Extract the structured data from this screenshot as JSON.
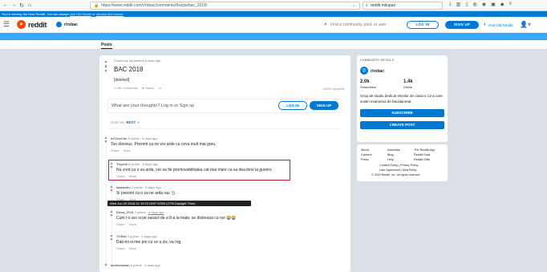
{
  "browser": {
    "url": "https://www.reddit.com/r/robac/comments/8xzpis/bac_2018/",
    "search_value": "reddit milupas"
  },
  "banner": {
    "text": "You're viewing the New Reddit. You can always",
    "link1": "visit Old Reddit",
    "mid": "or",
    "link2": "dismiss this banner"
  },
  "header": {
    "brand": "reddit",
    "subreddit": "r/robac",
    "search_placeholder": "Find a community, post, or user",
    "login": "LOG IN",
    "signup": "SIGN UP",
    "old_reddit": "Visit Old Reddit"
  },
  "tabs": {
    "posts": "Posts"
  },
  "post": {
    "meta": "Posted by u/[deleted] 6 days ago",
    "title": "BAC 2018",
    "body": "[deleted]",
    "comments": "56 Comments",
    "share": "Share",
    "upvoted": "100% Upvoted",
    "score": "1"
  },
  "comment_box": {
    "prompt": "What are your thoughts? Log in or Sign up",
    "login": "LOG IN",
    "signup": "SIGN UP"
  },
  "sort": {
    "label": "SORT BY",
    "value": "BEST"
  },
  "comments": [
    {
      "user": "hOZzzVvile",
      "points": "8 points",
      "time": "6 days ago",
      "body": "Too obvious. Presimt ca ne vor arde cu ceva mult mai greu.",
      "share": "Share",
      "save": "Save"
    },
    {
      "user": "Treyvoii",
      "points": "6 points",
      "time": "6 days ago",
      "body": "Nu cred ca o sa arda, vor sa fie promovabilitatea cat mai mare ca sa dea bine la guvern",
      "share": "Share",
      "save": "Save"
    },
    {
      "user": "fassandru",
      "points": "3 points",
      "time": "6 days ago",
      "body": "Si presimt ca o sa ne arda rau :))",
      "share": "Share",
      "save": "Save"
    },
    {
      "user": "Elena_2015",
      "points": "2 points",
      "time": "5 days ago",
      "body": "Cum i-o ars si pe saracii de a 8-a la mate, se distreaza cu noi 😭😭",
      "share": "Share",
      "save": "Save"
    },
    {
      "user": "YZ3ble",
      "points": "3 points",
      "time": "6 days ago",
      "body": "Dati-mi si mie pm cu ce a zis, va rog",
      "share": "Share",
      "save": "Save"
    },
    {
      "user": "andreeaorian",
      "points": "6 points",
      "time": "6 days ago",
      "body": "",
      "share": "",
      "save": ""
    }
  ],
  "tooltip": "Wed Jun 20 2018 01:19:15 GMT+0300 (GTB Daylight Time)",
  "sidebar": {
    "heading": "COMMUNITY DETAILS",
    "name": "r/robac",
    "subscribers_value": "2.0k",
    "subscribers_label": "Subscribers",
    "online_value": "1.4k",
    "online_label": "Online",
    "description": "Grup de studiu dedicat elevilor de clasa a 12-a care sustin examenul de bacalaureat.",
    "subscribe": "SUBSCRIBE",
    "create_post": "CREATE POST"
  },
  "footer": {
    "col1": [
      "About",
      "Careers",
      "Press"
    ],
    "col2": [
      "Advertise",
      "Blog",
      "Help"
    ],
    "col3": [
      "The Reddit App",
      "Reddit Gold",
      "Reddit Gifts"
    ],
    "legal1": "Content Policy | Privacy Policy",
    "legal2": "User Agreement | Mod Policy",
    "copyright": "© 2018 Reddit, Inc. All rights reserved"
  }
}
